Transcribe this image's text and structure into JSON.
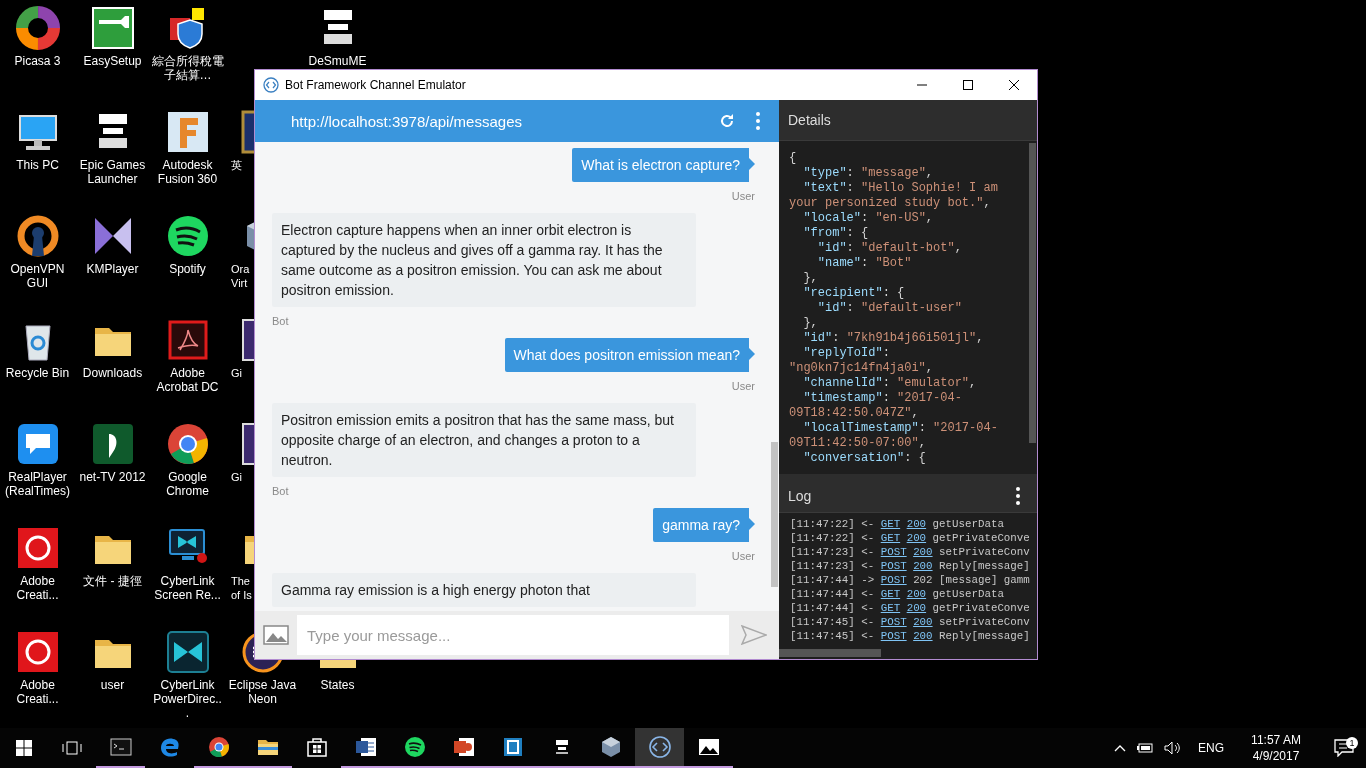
{
  "desktop": {
    "columns": [
      [
        {
          "label": "Picasa 3"
        },
        {
          "label": "This PC"
        },
        {
          "label": "OpenVPN GUI"
        },
        {
          "label": "Recycle Bin"
        },
        {
          "label": "RealPlayer (RealTimes)"
        },
        {
          "label": "Adobe Creati..."
        },
        {
          "label": "Adobe Creati..."
        }
      ],
      [
        {
          "label": "EasySetup"
        },
        {
          "label": "Epic Games Launcher"
        },
        {
          "label": "KMPlayer"
        },
        {
          "label": "Downloads"
        },
        {
          "label": "net-TV 2012"
        },
        {
          "label": "文件 - 捷徑"
        },
        {
          "label": "user"
        }
      ],
      [
        {
          "label": "綜合所得稅電子結算…"
        },
        {
          "label": "Autodesk Fusion 360"
        },
        {
          "label": "Spotify"
        },
        {
          "label": "Adobe Acrobat DC"
        },
        {
          "label": "Google Chrome"
        },
        {
          "label": "CyberLink Screen Re..."
        },
        {
          "label": "CyberLink PowerDirec..."
        }
      ],
      [
        null,
        {
          "label": "英"
        },
        {
          "label": "Ora\nVirt"
        },
        {
          "label": "Gi"
        },
        {
          "label": "Gi"
        },
        {
          "label": "The\nof Is"
        },
        {
          "label": "Eclipse Java Neon"
        }
      ],
      [
        {
          "label": "DeSmuME"
        },
        null,
        null,
        null,
        null,
        null,
        {
          "label": "States"
        }
      ]
    ]
  },
  "window": {
    "title": "Bot Framework Channel Emulator",
    "chat": {
      "endpoint": "http://localhost:3978/api/messages",
      "messages": [
        {
          "kind": "user",
          "text": "What is electron capture?",
          "sender": "User"
        },
        {
          "kind": "bot",
          "text": "Electron capture happens when an inner orbit electron is captured by the nucleus and gives off a gamma ray. It has the same outcome as a positron emission. You can ask me about positron emission.",
          "sender": "Bot"
        },
        {
          "kind": "user",
          "text": "What does positron emission mean?",
          "sender": "User"
        },
        {
          "kind": "bot",
          "text": "Positron emission emits a positron that has the same mass, but opposite charge of an electron, and changes a proton to a neutron.",
          "sender": "Bot"
        },
        {
          "kind": "user",
          "text": "gamma ray?",
          "sender": "User"
        },
        {
          "kind": "bot",
          "text": "Gamma ray emission is a high energy photon that"
        }
      ],
      "input": {
        "placeholder": "Type your message..."
      }
    },
    "details": {
      "title": "Details",
      "lines": [
        {
          "tokens": [
            {
              "kind": "punct",
              "text": "{"
            }
          ]
        },
        {
          "tokens": [
            {
              "kind": "key",
              "text": "  \"type\""
            },
            {
              "kind": "punct",
              "text": ": "
            },
            {
              "kind": "string",
              "text": "\"message\""
            },
            {
              "kind": "punct",
              "text": ","
            }
          ]
        },
        {
          "tokens": [
            {
              "kind": "key",
              "text": "  \"text\""
            },
            {
              "kind": "punct",
              "text": ": "
            },
            {
              "kind": "string",
              "text": "\"Hello Sophie! I am"
            }
          ]
        },
        {
          "tokens": [
            {
              "kind": "string",
              "text": "your personized study bot.\""
            },
            {
              "kind": "punct",
              "text": ","
            }
          ]
        },
        {
          "tokens": [
            {
              "kind": "key",
              "text": "  \"locale\""
            },
            {
              "kind": "punct",
              "text": ": "
            },
            {
              "kind": "string",
              "text": "\"en-US\""
            },
            {
              "kind": "punct",
              "text": ","
            }
          ]
        },
        {
          "tokens": [
            {
              "kind": "key",
              "text": "  \"from\""
            },
            {
              "kind": "punct",
              "text": ": {"
            }
          ]
        },
        {
          "tokens": [
            {
              "kind": "key",
              "text": "    \"id\""
            },
            {
              "kind": "punct",
              "text": ": "
            },
            {
              "kind": "string",
              "text": "\"default-bot\""
            },
            {
              "kind": "punct",
              "text": ","
            }
          ]
        },
        {
          "tokens": [
            {
              "kind": "key",
              "text": "    \"name\""
            },
            {
              "kind": "punct",
              "text": ": "
            },
            {
              "kind": "string",
              "text": "\"Bot\""
            }
          ]
        },
        {
          "tokens": [
            {
              "kind": "punct",
              "text": "  },"
            }
          ]
        },
        {
          "tokens": [
            {
              "kind": "key",
              "text": "  \"recipient\""
            },
            {
              "kind": "punct",
              "text": ": {"
            }
          ]
        },
        {
          "tokens": [
            {
              "kind": "key",
              "text": "    \"id\""
            },
            {
              "kind": "punct",
              "text": ": "
            },
            {
              "kind": "string",
              "text": "\"default-user\""
            }
          ]
        },
        {
          "tokens": [
            {
              "kind": "punct",
              "text": "  },"
            }
          ]
        },
        {
          "tokens": [
            {
              "kind": "key",
              "text": "  \"id\""
            },
            {
              "kind": "punct",
              "text": ": "
            },
            {
              "kind": "string",
              "text": "\"7kh91b4j66i501jl\""
            },
            {
              "kind": "punct",
              "text": ","
            }
          ]
        },
        {
          "tokens": [
            {
              "kind": "key",
              "text": "  \"replyToId\""
            },
            {
              "kind": "punct",
              "text": ":"
            }
          ]
        },
        {
          "tokens": [
            {
              "kind": "string",
              "text": "\"ng0kn7jc14fn4ja0i\""
            },
            {
              "kind": "punct",
              "text": ","
            }
          ]
        },
        {
          "tokens": [
            {
              "kind": "key",
              "text": "  \"channelId\""
            },
            {
              "kind": "punct",
              "text": ": "
            },
            {
              "kind": "string",
              "text": "\"emulator\""
            },
            {
              "kind": "punct",
              "text": ","
            }
          ]
        },
        {
          "tokens": [
            {
              "kind": "key",
              "text": "  \"timestamp\""
            },
            {
              "kind": "punct",
              "text": ": "
            },
            {
              "kind": "string",
              "text": "\"2017-04-"
            }
          ]
        },
        {
          "tokens": [
            {
              "kind": "string",
              "text": "09T18:42:50.047Z\""
            },
            {
              "kind": "punct",
              "text": ","
            }
          ]
        },
        {
          "tokens": [
            {
              "kind": "key",
              "text": "  \"localTimestamp\""
            },
            {
              "kind": "punct",
              "text": ": "
            },
            {
              "kind": "string",
              "text": "\"2017-04-"
            }
          ]
        },
        {
          "tokens": [
            {
              "kind": "string",
              "text": "09T11:42:50-07:00\""
            },
            {
              "kind": "punct",
              "text": ","
            }
          ]
        },
        {
          "tokens": [
            {
              "kind": "key",
              "text": "  \"conversation\""
            },
            {
              "kind": "punct",
              "text": ": {"
            }
          ]
        }
      ]
    },
    "log": {
      "title": "Log",
      "entries": [
        {
          "time": "[11:47:22]",
          "direction": "<-",
          "method": "GET",
          "status": "200",
          "status_link": true,
          "text": "getUserData"
        },
        {
          "time": "[11:47:22]",
          "direction": "<-",
          "method": "GET",
          "status": "200",
          "status_link": true,
          "text": "getPrivateConve"
        },
        {
          "time": "[11:47:23]",
          "direction": "<-",
          "method": "POST",
          "status": "200",
          "status_link": true,
          "text": "setPrivateConv"
        },
        {
          "time": "[11:47:23]",
          "direction": "<-",
          "method": "POST",
          "status": "200",
          "status_link": true,
          "text": "Reply[message]"
        },
        {
          "time": "[11:47:44]",
          "direction": "->",
          "method": "POST",
          "status": "202",
          "status_link": false,
          "text": "[message] gamm"
        },
        {
          "time": "[11:47:44]",
          "direction": "<-",
          "method": "GET",
          "status": "200",
          "status_link": true,
          "text": "getUserData"
        },
        {
          "time": "[11:47:44]",
          "direction": "<-",
          "method": "GET",
          "status": "200",
          "status_link": true,
          "text": "getPrivateConve"
        },
        {
          "time": "[11:47:45]",
          "direction": "<-",
          "method": "POST",
          "status": "200",
          "status_link": true,
          "text": "setPrivateConv"
        },
        {
          "time": "[11:47:45]",
          "direction": "<-",
          "method": "POST",
          "status": "200",
          "status_link": true,
          "text": "Reply[message]"
        }
      ]
    }
  },
  "taskbar": {
    "apps": [
      {
        "running": true,
        "selected": false
      },
      {
        "running": false,
        "selected": false
      },
      {
        "running": true,
        "selected": false
      },
      {
        "running": true,
        "selected": false
      },
      {
        "running": false,
        "selected": false
      },
      {
        "running": true,
        "selected": false
      },
      {
        "running": true,
        "selected": false
      },
      {
        "running": true,
        "selected": false
      },
      {
        "running": true,
        "selected": false
      },
      {
        "running": true,
        "selected": false
      },
      {
        "running": true,
        "selected": false
      },
      {
        "running": true,
        "selected": true
      },
      {
        "running": true,
        "selected": false
      }
    ],
    "tray": {
      "language": "ENG",
      "time": "11:57 AM",
      "date": "4/9/2017",
      "notification_count": "1"
    }
  }
}
